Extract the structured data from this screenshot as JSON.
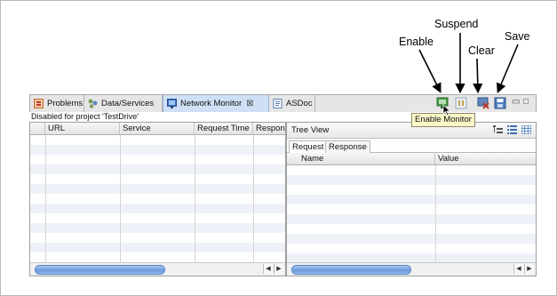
{
  "annotations": {
    "enable": "Enable",
    "suspend": "Suspend",
    "clear": "Clear",
    "save": "Save"
  },
  "tabs": [
    {
      "label": "Problems",
      "icon": "problems-icon"
    },
    {
      "label": "Data/Services",
      "icon": "data-services-icon"
    },
    {
      "label": "Network Monitor",
      "icon": "network-monitor-icon",
      "active": true
    },
    {
      "label": "ASDoc",
      "icon": "asdoc-icon"
    }
  ],
  "status": "Disabled for project 'TestDrive'",
  "requests_table": {
    "columns": [
      "URL",
      "Service",
      "Request Time",
      "Respon"
    ]
  },
  "detail_pane": {
    "title": "Tree View",
    "subtabs": [
      "Request",
      "Response"
    ],
    "columns": [
      "Name",
      "Value"
    ]
  },
  "tooltip": "Enable Monitor",
  "colors": {
    "active_tab": "#cfe0f6",
    "scroll_thumb": "#6f9bdc",
    "tooltip_bg": "#fbf7c9"
  }
}
